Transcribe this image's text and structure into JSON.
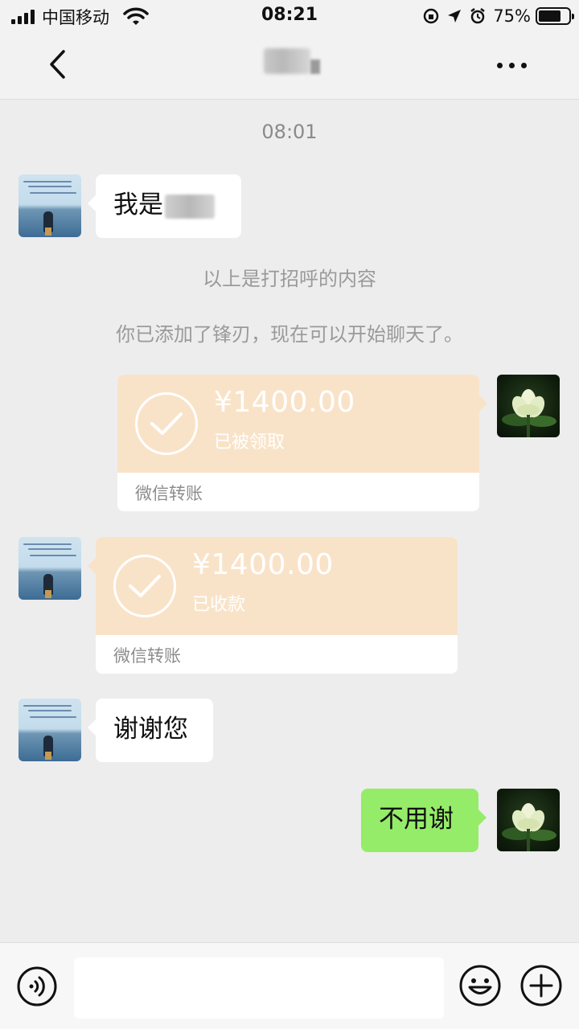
{
  "status_bar": {
    "carrier": "中国移动",
    "time": "08:21",
    "battery_percent": "75%",
    "battery_level": 0.75,
    "icons": [
      "signal-icon",
      "wifi-icon",
      "rotation-lock-icon",
      "location-icon",
      "alarm-icon",
      "battery-icon"
    ]
  },
  "nav": {
    "back_icon": "chevron-left-icon",
    "more_icon": "more-dots-icon"
  },
  "chat": {
    "timestamp": "08:01",
    "messages": [
      {
        "side": "left",
        "type": "text",
        "text": "我是"
      },
      {
        "side": "system",
        "type": "system",
        "text": "以上是打招呼的内容"
      },
      {
        "side": "system",
        "type": "system",
        "text": "你已添加了锋刃，现在可以开始聊天了。"
      },
      {
        "side": "right",
        "type": "transfer",
        "amount": "¥1400.00",
        "status": "已被领取",
        "footer": "微信转账"
      },
      {
        "side": "left",
        "type": "transfer",
        "amount": "¥1400.00",
        "status": "已收款",
        "footer": "微信转账"
      },
      {
        "side": "left",
        "type": "text",
        "text": "谢谢您"
      },
      {
        "side": "right",
        "type": "text",
        "text": "不用谢"
      }
    ]
  },
  "input_bar": {
    "voice_icon": "voice-icon",
    "input_value": "",
    "emoji_icon": "emoji-icon",
    "plus_icon": "plus-icon"
  },
  "colors": {
    "background": "#ededed",
    "bubble_green": "#95ec69",
    "transfer_bg": "#f9e3c8",
    "system_text": "#9a9a9a"
  }
}
